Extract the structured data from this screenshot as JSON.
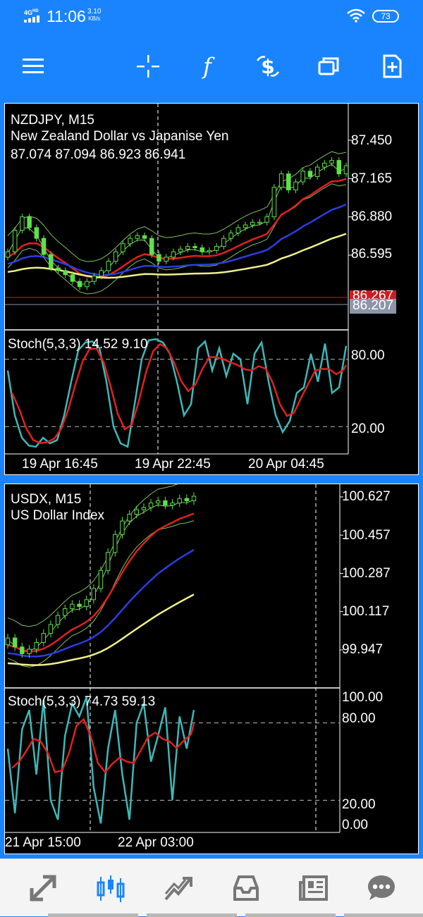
{
  "status": {
    "network": "4G",
    "network_sup": "HD",
    "time": "11:06",
    "speed_value": "3.10",
    "speed_unit": "KB/s",
    "battery": "73"
  },
  "toolbar": {
    "icons": [
      "menu-icon",
      "crosshair-icon",
      "function-icon",
      "currency-exchange-icon",
      "windows-icon",
      "add-document-icon"
    ]
  },
  "chart1": {
    "symbol_line": "NZDJPY, M15",
    "description": "New Zealand Dollar vs Japanise Yen",
    "ohlc": "87.074 87.094 86.923 86.941",
    "price_ticks": [
      "87.450",
      "87.165",
      "86.880",
      "86.595"
    ],
    "bid_tag": "86.267",
    "current_tag": "86.207",
    "indicator_label": "Stoch(5,3,3) 14.52 9.10",
    "indicator_ticks": [
      "80.00",
      "20.00"
    ],
    "time_ticks": [
      "19 Apr 16:45",
      "19 Apr 22:45",
      "20 Apr 04:45"
    ]
  },
  "chart2": {
    "symbol_line": "USDX, M15",
    "description": "US Dollar Index",
    "price_ticks": [
      "100.627",
      "100.457",
      "100.287",
      "100.117",
      "99.947"
    ],
    "indicator_label": "Stoch(5,3,3) 74.73 59.13",
    "indicator_ticks": [
      "100.00",
      "80.00",
      "20.00",
      "0.00"
    ],
    "time_ticks": [
      "21 Apr 15:00",
      "22 Apr 03:00"
    ]
  },
  "chart_data": [
    {
      "type": "candlestick",
      "symbol": "NZDJPY",
      "timeframe": "M15",
      "y_ticks": [
        87.45,
        87.165,
        86.88,
        86.595
      ],
      "bid_price": 86.267,
      "current_price": 86.207,
      "close_series": [
        86.62,
        86.78,
        86.88,
        86.8,
        86.72,
        86.6,
        86.5,
        86.48,
        86.45,
        86.4,
        86.36,
        86.4,
        86.44,
        86.48,
        86.55,
        86.62,
        86.68,
        86.72,
        86.74,
        86.72,
        86.6,
        86.55,
        86.58,
        86.62,
        86.64,
        86.66,
        86.65,
        86.62,
        86.63,
        86.66,
        86.72,
        86.76,
        86.8,
        86.82,
        86.84,
        86.84,
        86.88,
        87.1,
        87.2,
        87.08,
        87.14,
        87.22,
        87.18,
        87.25,
        87.28,
        87.3,
        87.2,
        87.26
      ],
      "indicator": {
        "name": "Stoch(5,3,3)",
        "main": 14.52,
        "signal": 9.1,
        "levels": [
          80,
          20
        ],
        "main_series": [
          70,
          30,
          10,
          3,
          2,
          10,
          5,
          8,
          30,
          60,
          88,
          95,
          96,
          90,
          60,
          20,
          5,
          2,
          40,
          80,
          97,
          98,
          95,
          85,
          60,
          30,
          40,
          90,
          96,
          70,
          90,
          65,
          85,
          80,
          40,
          85,
          95,
          60,
          30,
          15,
          25,
          50,
          55,
          85,
          60,
          94,
          50,
          55,
          92
        ]
      },
      "x_ticks": [
        "19 Apr 16:45",
        "19 Apr 22:45",
        "20 Apr 04:45"
      ]
    },
    {
      "type": "candlestick",
      "symbol": "USDX",
      "timeframe": "M15",
      "y_ticks": [
        100.627,
        100.457,
        100.287,
        100.117,
        99.947
      ],
      "close_series": [
        100.0,
        99.96,
        99.93,
        99.95,
        99.98,
        100.02,
        100.06,
        100.1,
        100.13,
        100.15,
        100.14,
        100.17,
        100.22,
        100.3,
        100.38,
        100.46,
        100.52,
        100.55,
        100.57,
        100.58,
        100.6,
        100.61,
        100.59,
        100.6,
        100.62,
        100.61,
        100.63
      ],
      "indicator": {
        "name": "Stoch(5,3,3)",
        "main": 74.73,
        "signal": 59.13,
        "levels": [
          100,
          80,
          20,
          0
        ],
        "main_series": [
          60,
          10,
          75,
          90,
          40,
          98,
          20,
          5,
          70,
          95,
          85,
          100,
          30,
          2,
          60,
          90,
          40,
          5,
          80,
          95,
          50,
          70,
          92,
          20,
          85,
          60,
          90
        ]
      },
      "x_ticks": [
        "21 Apr 15:00",
        "22 Apr 03:00"
      ]
    }
  ],
  "bottom_nav": {
    "icons": [
      "quotes-icon",
      "chart-icon",
      "trade-icon",
      "history-icon",
      "news-icon",
      "messages-icon"
    ]
  }
}
